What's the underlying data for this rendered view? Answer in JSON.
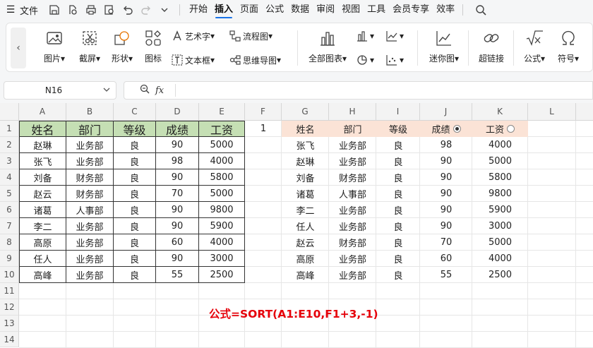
{
  "menubar": {
    "file_label": "文件",
    "tabs": [
      "开始",
      "插入",
      "页面",
      "公式",
      "数据",
      "审阅",
      "视图",
      "工具",
      "会员专享",
      "效率"
    ],
    "active_tab": "插入"
  },
  "ribbon": {
    "picture": "图片",
    "screenshot": "截屏",
    "shape": "形状",
    "icon": "图标",
    "wordart": "艺术字",
    "textbox": "文本框",
    "flowchart": "流程图",
    "mindmap": "思维导图",
    "all_charts": "全部图表",
    "sparkline": "迷你图",
    "hyperlink": "超链接",
    "formula": "公式",
    "symbol": "符号"
  },
  "formula_bar": {
    "name_box": "N16",
    "fx_label": "fx",
    "content": ""
  },
  "sheet": {
    "columns": [
      "A",
      "B",
      "C",
      "D",
      "E",
      "F",
      "G",
      "H",
      "I",
      "J",
      "K",
      "L"
    ],
    "rows": [
      "1",
      "2",
      "3",
      "4",
      "5",
      "6",
      "7",
      "8",
      "9",
      "10",
      "11",
      "12",
      "13",
      "14"
    ],
    "f1_value": "1",
    "source_headers": [
      "姓名",
      "部门",
      "等级",
      "成绩",
      "工资"
    ],
    "source_rows": [
      [
        "赵琳",
        "业务部",
        "良",
        "90",
        "5000"
      ],
      [
        "张飞",
        "业务部",
        "良",
        "98",
        "4000"
      ],
      [
        "刘备",
        "财务部",
        "良",
        "90",
        "5800"
      ],
      [
        "赵云",
        "财务部",
        "良",
        "70",
        "5000"
      ],
      [
        "诸葛",
        "人事部",
        "良",
        "90",
        "9800"
      ],
      [
        "李二",
        "业务部",
        "良",
        "90",
        "5900"
      ],
      [
        "高原",
        "业务部",
        "良",
        "60",
        "4000"
      ],
      [
        "任人",
        "业务部",
        "良",
        "90",
        "3000"
      ],
      [
        "高峰",
        "业务部",
        "良",
        "55",
        "2500"
      ]
    ],
    "result_headers": [
      "姓名",
      "部门",
      "等级",
      "成绩",
      "工资"
    ],
    "result_rows": [
      [
        "张飞",
        "业务部",
        "良",
        "98",
        "4000"
      ],
      [
        "赵琳",
        "业务部",
        "良",
        "90",
        "5000"
      ],
      [
        "刘备",
        "财务部",
        "良",
        "90",
        "5800"
      ],
      [
        "诸葛",
        "人事部",
        "良",
        "90",
        "9800"
      ],
      [
        "李二",
        "业务部",
        "良",
        "90",
        "5900"
      ],
      [
        "任人",
        "业务部",
        "良",
        "90",
        "3000"
      ],
      [
        "赵云",
        "财务部",
        "良",
        "70",
        "5000"
      ],
      [
        "高原",
        "业务部",
        "良",
        "60",
        "4000"
      ],
      [
        "高峰",
        "业务部",
        "良",
        "55",
        "2500"
      ]
    ],
    "selected_option": "成绩",
    "formula_note": "公式=SORT(A1:E10,F1+3,-1)"
  }
}
